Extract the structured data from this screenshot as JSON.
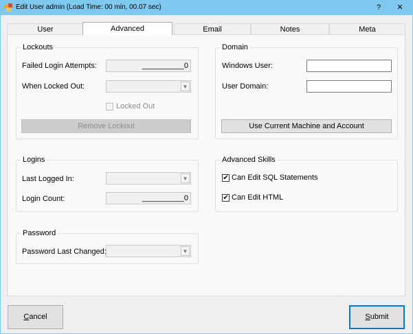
{
  "window": {
    "title": "Edit User admin (Load Time: 00 min, 00.07 sec)",
    "help_label": "?",
    "close_label": "✕"
  },
  "tabs": [
    {
      "label": "User",
      "active": false
    },
    {
      "label": "Advanced",
      "active": true
    },
    {
      "label": "Email",
      "active": false
    },
    {
      "label": "Notes",
      "active": false
    },
    {
      "label": "Meta",
      "active": false
    }
  ],
  "lockouts": {
    "title": "Lockouts",
    "failed_label": "Failed Login Attempts:",
    "failed_value": "__________0",
    "when_locked_label": "When Locked Out:",
    "when_locked_value": "",
    "locked_out_label": "Locked Out",
    "remove_button": "Remove Lockout"
  },
  "domain": {
    "title": "Domain",
    "windows_user_label": "Windows User:",
    "windows_user_value": "",
    "user_domain_label": "User Domain:",
    "user_domain_value": "",
    "use_current_button": "Use Current Machine and Account"
  },
  "logins": {
    "title": "Logins",
    "last_logged_label": "Last Logged In:",
    "last_logged_value": "",
    "count_label": "Login Count:",
    "count_value": "__________0"
  },
  "skills": {
    "title": "Advanced Skills",
    "sql_label": "Can Edit SQL Statements",
    "sql_checked": true,
    "html_label": "Can Edit HTML",
    "html_checked": true
  },
  "password": {
    "title": "Password",
    "last_changed_label": "Password Last Changed:",
    "last_changed_value": ""
  },
  "footer": {
    "cancel_first": "C",
    "cancel_rest": "ancel",
    "submit_first": "S",
    "submit_rest": "ubmit"
  },
  "icons": {
    "checkmark": "✔",
    "dropdown": "▼"
  },
  "colors": {
    "titlebar": "#7fc8f0",
    "primary_border": "#0078d7"
  }
}
